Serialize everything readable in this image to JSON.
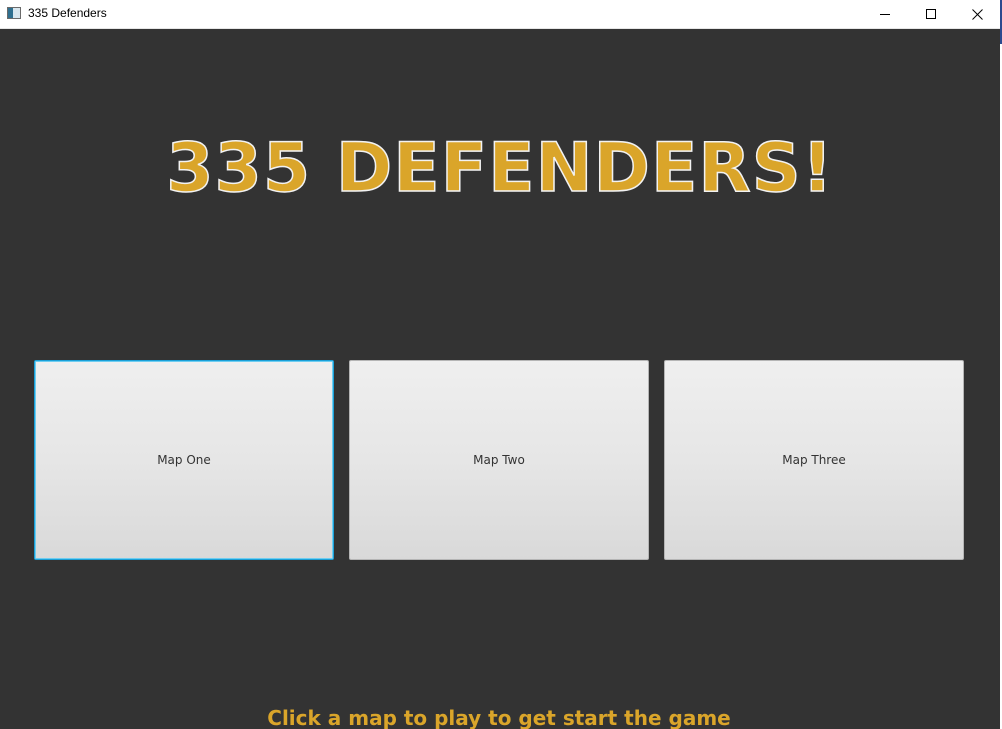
{
  "window": {
    "title": "335 Defenders",
    "controls": {
      "minimize_icon": "minimize-icon",
      "maximize_icon": "maximize-icon",
      "close_icon": "close-icon"
    }
  },
  "game": {
    "title": "335 DEFENDERS!",
    "maps": [
      {
        "label": "Map One",
        "focused": true
      },
      {
        "label": "Map Two",
        "focused": false
      },
      {
        "label": "Map Three",
        "focused": false
      }
    ],
    "hint": "Click a map to play to get start the game"
  },
  "colors": {
    "background": "#333333",
    "accent_gold": "#daa52a",
    "button_face": "#e6e6e6",
    "focus_ring": "#1aa0d8"
  }
}
